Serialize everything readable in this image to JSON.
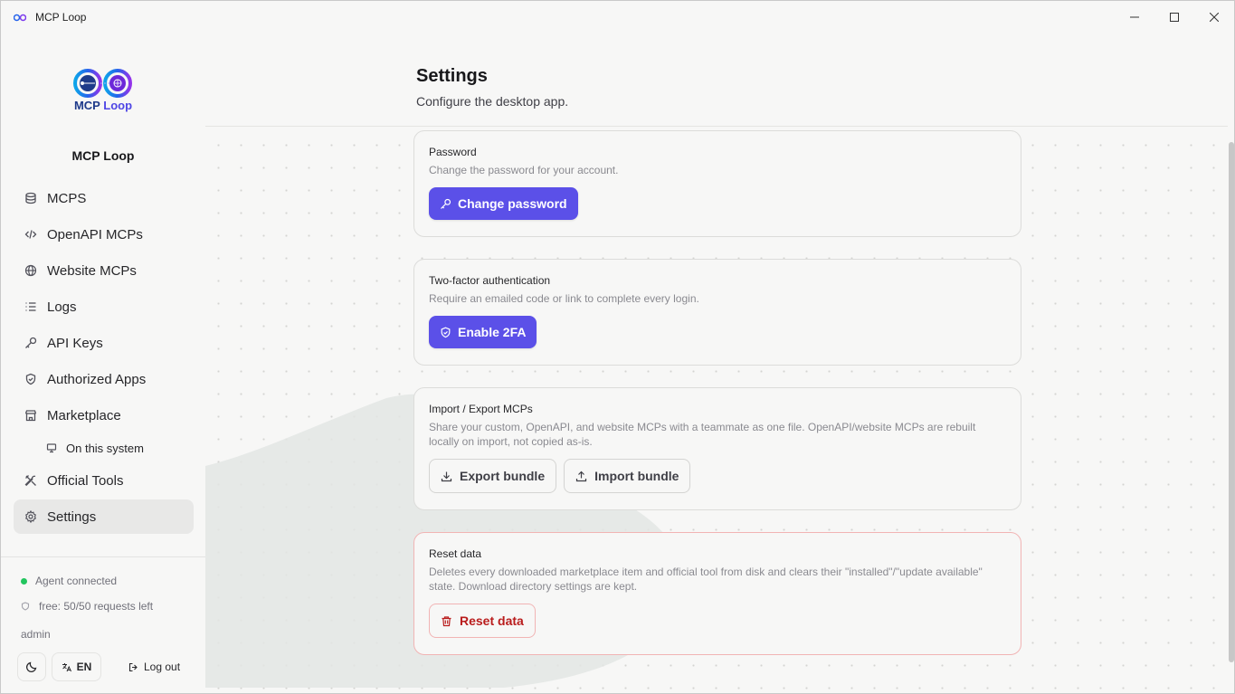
{
  "window": {
    "title": "MCP Loop",
    "controls": {
      "minimize": "minimize-icon",
      "maximize": "maximize-icon",
      "close": "close-icon"
    }
  },
  "sidebar": {
    "logo_text_main": "MCP",
    "logo_text_accent": "Loop",
    "brand_name": "MCP Loop",
    "items": [
      {
        "label": "MCPS",
        "icon": "database-icon"
      },
      {
        "label": "OpenAPI MCPs",
        "icon": "code-icon"
      },
      {
        "label": "Website MCPs",
        "icon": "globe-icon"
      },
      {
        "label": "Logs",
        "icon": "list-icon"
      },
      {
        "label": "API Keys",
        "icon": "key-icon"
      },
      {
        "label": "Authorized Apps",
        "icon": "shield-icon"
      },
      {
        "label": "Marketplace",
        "icon": "store-icon"
      },
      {
        "label": "On this system",
        "icon": "monitor-icon"
      },
      {
        "label": "Official Tools",
        "icon": "tools-icon"
      },
      {
        "label": "Settings",
        "icon": "gear-icon"
      }
    ],
    "status_agent": "Agent connected",
    "status_plan": "free: 50/50 requests left",
    "user": "admin",
    "lang": "EN",
    "logout": "Log out"
  },
  "page": {
    "title": "Settings",
    "subtitle": "Configure the desktop app."
  },
  "cards": {
    "password": {
      "title": "Password",
      "description": "Change the password for your account.",
      "button": "Change password"
    },
    "twofa": {
      "title": "Two-factor authentication",
      "description": "Require an emailed code or link to complete every login.",
      "button": "Enable 2FA"
    },
    "import_export": {
      "title": "Import / Export MCPs",
      "description": "Share your custom, OpenAPI, and website MCPs with a teammate as one file. OpenAPI/website MCPs are rebuilt locally on import, not copied as-is.",
      "export_button": "Export bundle",
      "import_button": "Import bundle"
    },
    "reset": {
      "title": "Reset data",
      "description": "Deletes every downloaded marketplace item and official tool from disk and clears their \"installed\"/\"update available\" state. Download directory settings are kept.",
      "button": "Reset data"
    }
  },
  "colors": {
    "primary": "#5b50e8",
    "danger": "#b91c1c",
    "status_ok": "#22c55e"
  }
}
